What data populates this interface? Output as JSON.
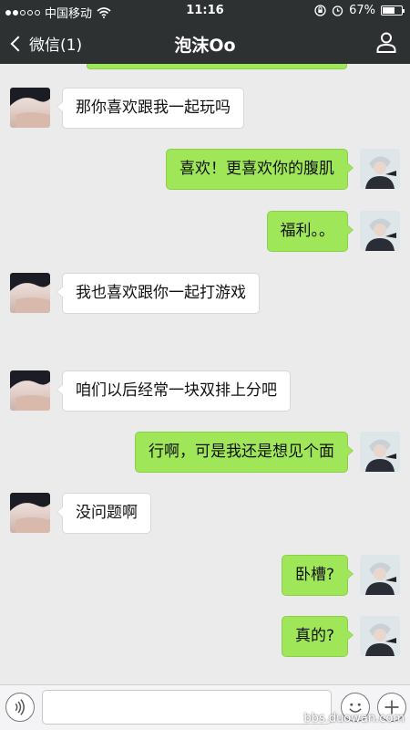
{
  "status_bar": {
    "carrier": "中国移动",
    "time": "11:16",
    "battery": "67%",
    "battery_level": 0.67,
    "signal_bars_filled": 2,
    "signal_bars_total": 5
  },
  "nav": {
    "back_label": "微信(1)",
    "title": "泡沫Oo"
  },
  "messages": [
    {
      "side": "left",
      "text": "那你喜欢跟我一起玩吗"
    },
    {
      "side": "right",
      "text": "喜欢！更喜欢你的腹肌"
    },
    {
      "side": "right",
      "text": "福利。。"
    },
    {
      "side": "left",
      "text": "我也喜欢跟你一起打游戏"
    },
    {
      "side": "left",
      "text": "咱们以后经常一块双排上分吧"
    },
    {
      "side": "right",
      "text": "行啊，可是我还是想见个面"
    },
    {
      "side": "left",
      "text": "没问题啊"
    },
    {
      "side": "right",
      "text": "卧槽?"
    },
    {
      "side": "right",
      "text": "真的?"
    }
  ],
  "input": {
    "value": "",
    "placeholder": ""
  },
  "watermark": "bbs.duowan.com",
  "colors": {
    "bar_bg": "#2e3132",
    "chat_bg": "#ebebeb",
    "bubble_self": "#9fe659",
    "bubble_other": "#ffffff"
  },
  "icons": {
    "back": "chevron-left-icon",
    "profile": "person-icon",
    "voice": "voice-icon",
    "emoji": "smiley-icon",
    "more": "plus-icon",
    "wifi": "wifi-icon",
    "lock": "rotation-lock-icon",
    "alarm": "alarm-icon"
  }
}
